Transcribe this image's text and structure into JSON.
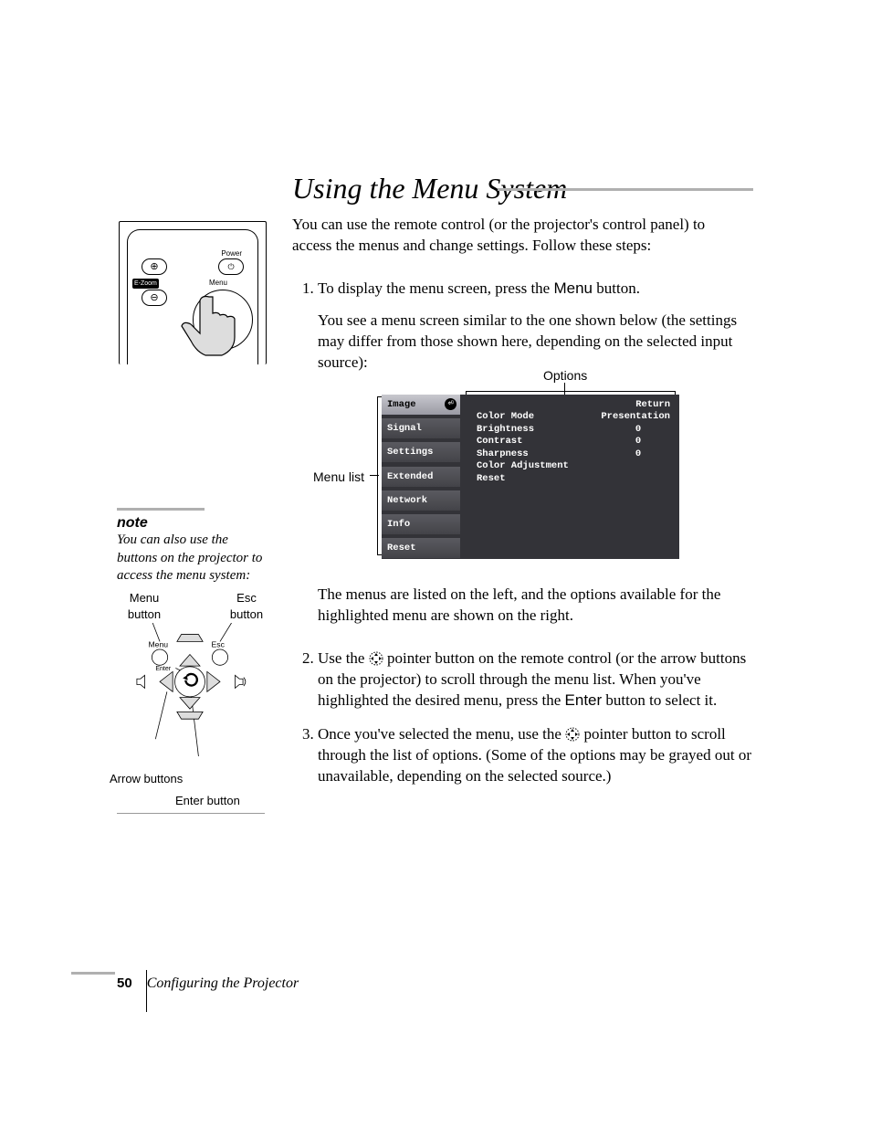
{
  "heading": "Using the Menu System",
  "intro": "You can use the remote control (or the projector's control panel) to access the menus and change settings. Follow these steps:",
  "step1_a": "To display the menu screen, press the ",
  "step1_btn": "Menu",
  "step1_b": " button.",
  "step1_sub": "You see a menu screen similar to the one shown below (the settings may differ from those shown here, depending on the selected input source):",
  "fig_options_label": "Options",
  "fig_menulist_label": "Menu list",
  "osd": {
    "menu": [
      "Image",
      "Signal",
      "Settings",
      "Extended",
      "Network",
      "Info",
      "Reset"
    ],
    "selected": 0,
    "return": "Return",
    "rows": [
      {
        "k": "Color Mode",
        "v": "Presentation"
      },
      {
        "k": "Brightness",
        "v": "0"
      },
      {
        "k": "Contrast",
        "v": "0"
      },
      {
        "k": "Sharpness",
        "v": "0"
      },
      {
        "k": "Color Adjustment",
        "v": ""
      },
      {
        "k": "Reset",
        "v": ""
      }
    ]
  },
  "after_fig": "The menus are listed on the left, and the options available for the highlighted menu are shown on the right.",
  "step2_a": "Use the ",
  "step2_b": " pointer button on the remote control (or the arrow buttons on the projector) to scroll through the menu list. When you've highlighted the desired menu, press the ",
  "step2_btn": "Enter",
  "step2_c": " button to select it.",
  "step3_a": "Once you've selected the menu, use the ",
  "step3_b": " pointer button to scroll through the list of options. (Some of the options may be grayed out or unavailable, depending on the selected source.)",
  "note_head": "note",
  "note_body": "You can also use the buttons on the projector to access the menu system:",
  "ctrl_labels": {
    "menu": "Menu button",
    "esc": "Esc button",
    "arrows": "Arrow buttons",
    "enter": "Enter button",
    "panel_menu": "Menu",
    "panel_esc": "Esc",
    "panel_enter": "Enter"
  },
  "remote": {
    "power": "Power",
    "menu": "Menu",
    "ezoom": "E-Zoom"
  },
  "footer": {
    "page": "50",
    "title": "Configuring the Projector"
  }
}
